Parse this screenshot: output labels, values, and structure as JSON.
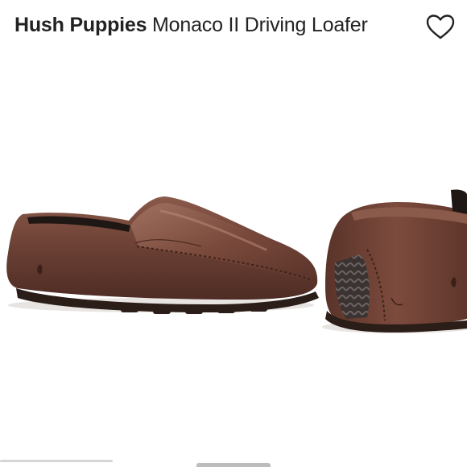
{
  "header": {
    "brand": "Hush Puppies",
    "product_name": "Monaco II Driving Loafer",
    "favorite_icon": "heart-outline-icon"
  },
  "gallery": {
    "image_subject": "brown-leather-driving-loafer",
    "colors": {
      "leather": "#6b3f33",
      "leather_highlight": "#8a5a4b",
      "sole": "#2b1d18",
      "background": "#ffffff"
    }
  }
}
